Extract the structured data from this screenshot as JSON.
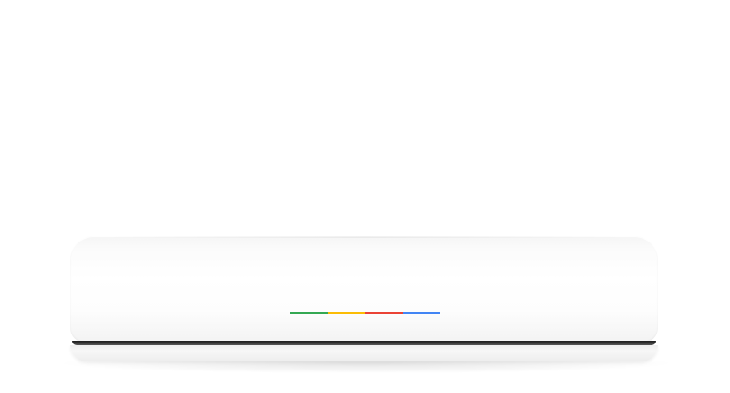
{
  "scene": {
    "subject": "closed-laptop",
    "background_color": "#ffffff",
    "body_color": "#ffffff",
    "seam_color": "#2a2a2a"
  },
  "light_bar": {
    "segments": [
      {
        "name": "green",
        "color": "#34a853"
      },
      {
        "name": "yellow",
        "color": "#fbbc05"
      },
      {
        "name": "red",
        "color": "#ea4335"
      },
      {
        "name": "blue",
        "color": "#4285f4"
      }
    ]
  }
}
